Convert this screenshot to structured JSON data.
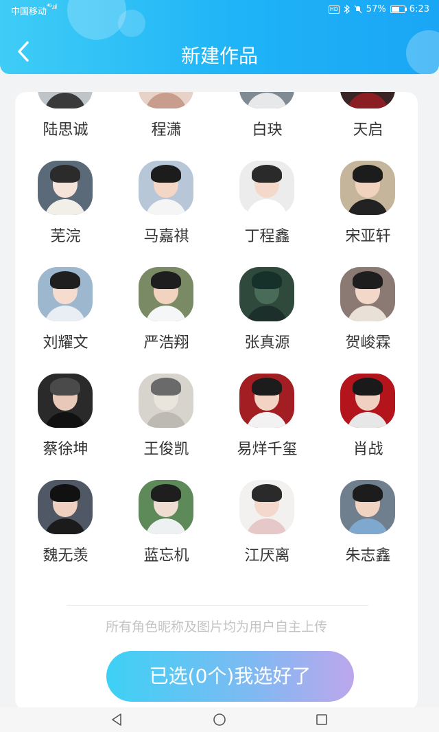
{
  "status_bar": {
    "carrier": "中国移动",
    "signal": "⁴ᴳ.ııl",
    "battery": "57%",
    "time": "6:23"
  },
  "header": {
    "title": "新建作品"
  },
  "characters": [
    {
      "name": "陆思诚",
      "colors": [
        "#bfc4c8",
        "#f1d6c6",
        "#1e1e1e",
        "#3a3a3a"
      ]
    },
    {
      "name": "程潇",
      "colors": [
        "#e6d2c6",
        "#f3d7c8",
        "#7b5440",
        "#c99d8e"
      ]
    },
    {
      "name": "白玦",
      "colors": [
        "#7f8a92",
        "#ead8cc",
        "#222",
        "#e7e8ea"
      ]
    },
    {
      "name": "天启",
      "colors": [
        "#3a2524",
        "#e9cabc",
        "#2a1a1a",
        "#8b1e22"
      ]
    },
    {
      "name": "芜浣",
      "colors": [
        "#5b6a78",
        "#f5e3da",
        "#2b2b2b",
        "#f2efe9"
      ]
    },
    {
      "name": "马嘉祺",
      "colors": [
        "#b7c7d8",
        "#f3d6c6",
        "#1c1c1c",
        "#f5f5f5"
      ]
    },
    {
      "name": "丁程鑫",
      "colors": [
        "#ececec",
        "#f4d9cb",
        "#2a2a2a",
        "#ffffff"
      ]
    },
    {
      "name": "宋亚轩",
      "colors": [
        "#c5b59a",
        "#f0d2bf",
        "#1c1c1c",
        "#222222"
      ]
    },
    {
      "name": "刘耀文",
      "colors": [
        "#9cb7ce",
        "#f5dcce",
        "#1f1f1f",
        "#e8eef3"
      ]
    },
    {
      "name": "严浩翔",
      "colors": [
        "#7a8a64",
        "#f1d3c0",
        "#1e1e1e",
        "#f4f6f8"
      ]
    },
    {
      "name": "张真源",
      "colors": [
        "#2f4a3c",
        "#496c58",
        "#16302a",
        "#1d2f2a"
      ]
    },
    {
      "name": "贺峻霖",
      "colors": [
        "#8b7a73",
        "#f3d7c8",
        "#1e1e1e",
        "#e9e0d8"
      ]
    },
    {
      "name": "蔡徐坤",
      "colors": [
        "#2a2a2a",
        "#e8c9b9",
        "#4a4a4a",
        "#111111"
      ]
    },
    {
      "name": "王俊凯",
      "colors": [
        "#d7d4cd",
        "#e9e4dc",
        "#6a6a6a",
        "#bdbab3"
      ]
    },
    {
      "name": "易烊千玺",
      "colors": [
        "#a31e22",
        "#f3d4c4",
        "#1c1c1c",
        "#f2f2f2"
      ]
    },
    {
      "name": "肖战",
      "colors": [
        "#b4151c",
        "#f0d0c0",
        "#1a1a1a",
        "#e7e7e7"
      ]
    },
    {
      "name": "魏无羡",
      "colors": [
        "#4f5864",
        "#eecfc0",
        "#111111",
        "#1b1b1b"
      ]
    },
    {
      "name": "蓝忘机",
      "colors": [
        "#5e8a5a",
        "#f0ddd2",
        "#1e1e1e",
        "#eef1f2"
      ]
    },
    {
      "name": "江厌离",
      "colors": [
        "#f3f1ef",
        "#f3d8cb",
        "#2a2a2a",
        "#e7c8c8"
      ]
    },
    {
      "name": "朱志鑫",
      "colors": [
        "#6f7f8d",
        "#f1d3c2",
        "#1c1c1c",
        "#7fa8cf"
      ]
    }
  ],
  "footer": {
    "disclaimer": "所有角色昵称及图片均为用户自主上传",
    "confirm_label": "已选(0个)我选好了"
  },
  "icons": {
    "back": "back-arrow-icon",
    "nav_back": "nav-back-icon",
    "nav_home": "nav-home-icon",
    "nav_recent": "nav-recent-icon"
  }
}
